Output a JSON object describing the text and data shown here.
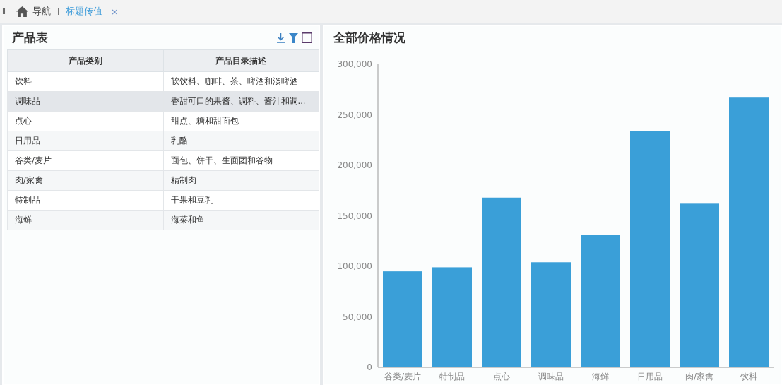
{
  "nav": {
    "menu_glyph": "III",
    "home_label": "导航",
    "tabs": [
      {
        "label": "标题传值",
        "selected": true,
        "close": "×"
      }
    ]
  },
  "table_panel": {
    "title": "产品表",
    "columns": [
      "产品类别",
      "产品目录描述"
    ],
    "rows": [
      {
        "cells": [
          "饮料",
          "软饮料、咖啡、茶、啤酒和淡啤酒"
        ],
        "selected": false
      },
      {
        "cells": [
          "调味品",
          "香甜可口的果酱、调料、酱汁和调..."
        ],
        "selected": true
      },
      {
        "cells": [
          "点心",
          "甜点、糖和甜面包"
        ],
        "selected": false
      },
      {
        "cells": [
          "日用品",
          "乳酪"
        ],
        "selected": false
      },
      {
        "cells": [
          "谷类/麦片",
          "面包、饼干、生面团和谷物"
        ],
        "selected": false
      },
      {
        "cells": [
          "肉/家禽",
          "精制肉"
        ],
        "selected": false
      },
      {
        "cells": [
          "特制品",
          "干果和豆乳"
        ],
        "selected": false
      },
      {
        "cells": [
          "海鲜",
          "海菜和鱼"
        ],
        "selected": false
      }
    ]
  },
  "chart_panel": {
    "title": "全部价格情况",
    "chart_data": {
      "type": "bar",
      "categories": [
        "谷类/麦片",
        "特制品",
        "点心",
        "调味品",
        "海鲜",
        "日用品",
        "肉/家禽",
        "饮料"
      ],
      "series": [
        {
          "color": "#3a9fd8",
          "values": [
            95000,
            99000,
            168000,
            104000,
            131000,
            234000,
            162000,
            267000
          ]
        }
      ],
      "ylim": [
        0,
        300000
      ],
      "yticks": [
        {
          "value": 0,
          "label": "0"
        },
        {
          "value": 50000,
          "label": "50,000"
        },
        {
          "value": 100000,
          "label": "100,000"
        },
        {
          "value": 150000,
          "label": "150,000"
        },
        {
          "value": 200000,
          "label": "200,000"
        },
        {
          "value": 250000,
          "label": "250,000"
        },
        {
          "value": 300000,
          "label": "300,000"
        }
      ]
    }
  }
}
